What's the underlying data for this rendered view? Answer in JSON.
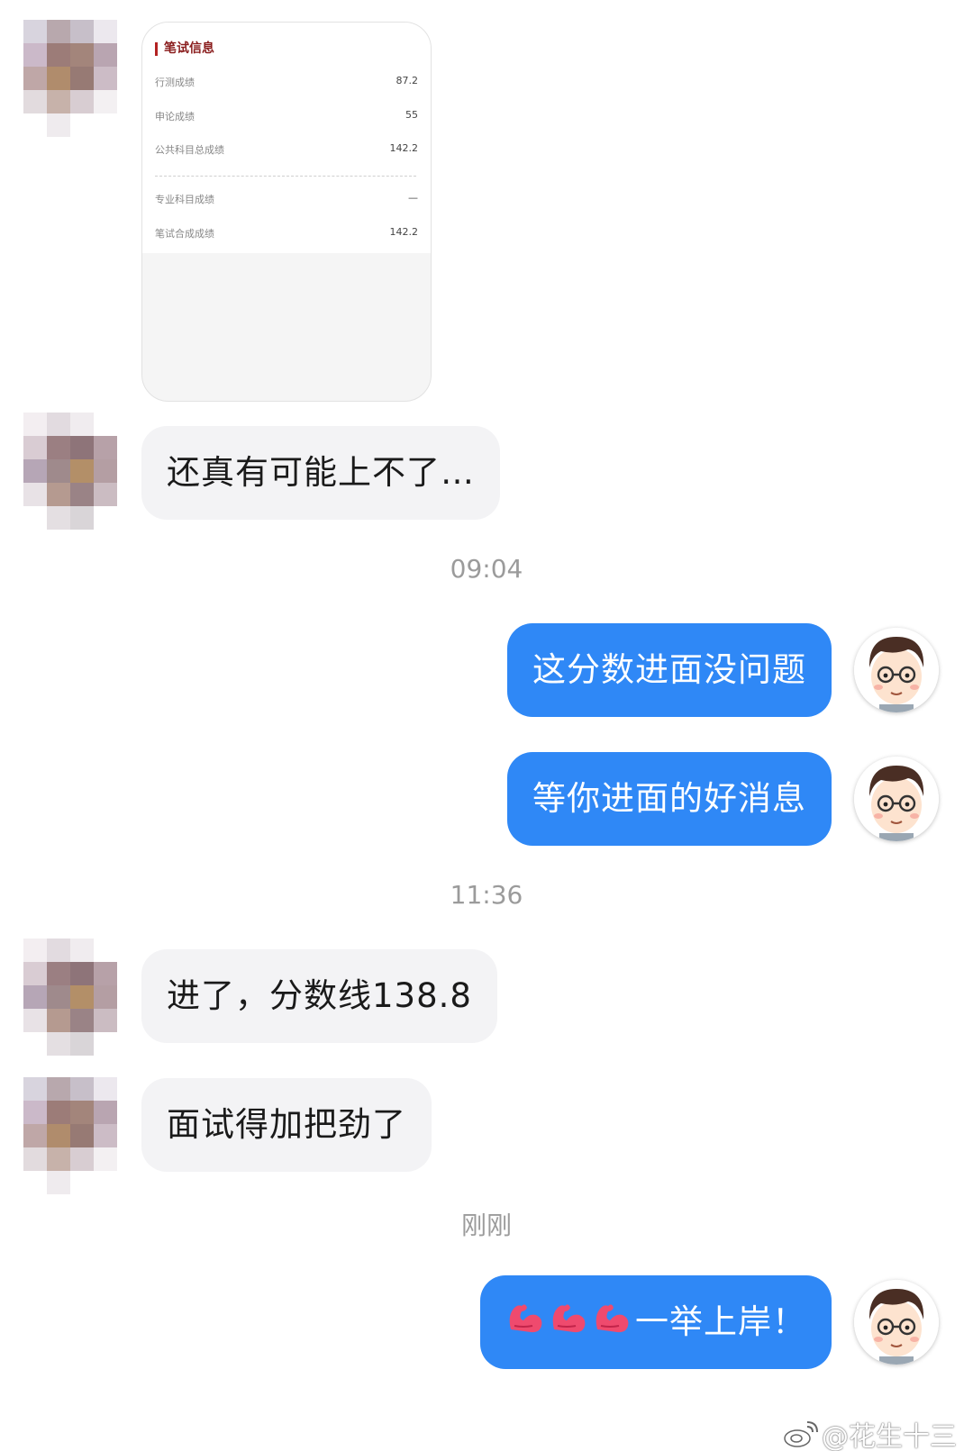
{
  "score_card": {
    "title": "笔试信息",
    "rows": [
      {
        "label": "行测成绩",
        "value": "87.2"
      },
      {
        "label": "申论成绩",
        "value": "55"
      },
      {
        "label": "公共科目总成绩",
        "value": "142.2"
      },
      {
        "label": "专业科目成绩",
        "value": "—"
      },
      {
        "label": "笔试合成成绩",
        "value": "142.2"
      }
    ]
  },
  "messages": [
    {
      "side": "left",
      "text": "还真有可能上不了…"
    },
    {
      "side": "right",
      "text": "这分数进面没问题"
    },
    {
      "side": "right",
      "text": "等你进面的好消息"
    },
    {
      "side": "left",
      "text": "进了，分数线138.8"
    },
    {
      "side": "left",
      "text": "面试得加把劲了"
    },
    {
      "side": "right",
      "text": "一举上岸！",
      "emoji": "flexed-biceps x3"
    }
  ],
  "timestamps": [
    "09:04",
    "11:36",
    "刚刚"
  ],
  "watermark": "@花生十三",
  "colors": {
    "right_bubble": "#2f88f6",
    "left_bubble": "#f3f3f5",
    "card_accent": "#b32222"
  }
}
